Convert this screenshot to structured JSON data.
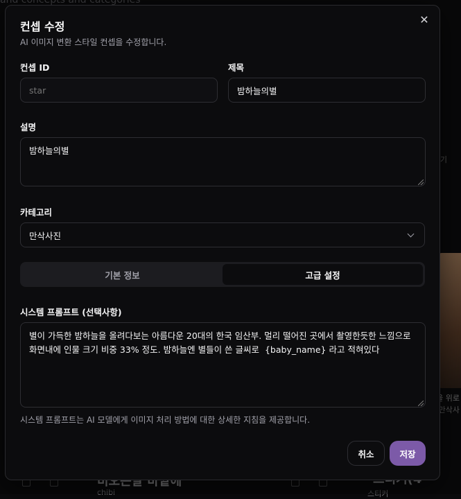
{
  "background": {
    "top_text": "and concepts and categories",
    "right_top": "기",
    "right_caption_1": "을 위로",
    "right_caption_2": "만삭사",
    "bottom_left_title": "비오는날 바깥에",
    "bottom_left_sub": "chibi",
    "bottom_right_title": "스티커(4",
    "bottom_right_sub": "스티커"
  },
  "modal": {
    "title": "컨셉 수정",
    "subtitle": "AI 이미지 변환 스타일 컨셉을 수정합니다.",
    "close_icon": "close-icon"
  },
  "form": {
    "concept_id": {
      "label": "컨셉 ID",
      "value": "",
      "placeholder": "star"
    },
    "title": {
      "label": "제목",
      "value": "밤하늘의별"
    },
    "description": {
      "label": "설명",
      "value": "밤하늘의별"
    },
    "category": {
      "label": "카테고리",
      "value": "만삭사진"
    },
    "tabs": [
      {
        "label": "기본 정보",
        "active": false
      },
      {
        "label": "고급 설정",
        "active": true
      }
    ],
    "system_prompt": {
      "label": "시스템 프롬프트 (선택사항)",
      "value": "별이 가득한 밤하늘을 올려다보는 아름다운 20대의 한국 임산부. 멀리 떨어진 곳에서 촬영한듯한 느낌으로 화면내에 인물 크기 비중 33% 정도. 밤하늘엔 별들이 쓴 글씨로  {baby_name} 라고 적혀있다",
      "helper": "시스템 프롬프트는 AI 모델에게 이미지 처리 방법에 대한 상세한 지침을 제공합니다."
    }
  },
  "actions": {
    "cancel_label": "취소",
    "save_label": "저장"
  },
  "colors": {
    "accent": "#7c5aa8",
    "border": "#2e2e33",
    "modal_bg": "#0c0c0e"
  }
}
